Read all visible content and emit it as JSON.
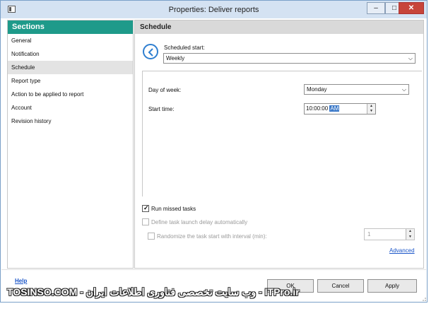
{
  "window": {
    "title": "Properties: Deliver reports",
    "minimize_label": "–",
    "maximize_label": "□",
    "close_label": "✕"
  },
  "sidebar": {
    "header": "Sections",
    "items": [
      {
        "label": "General"
      },
      {
        "label": "Notification"
      },
      {
        "label": "Schedule",
        "selected": true
      },
      {
        "label": "Report type"
      },
      {
        "label": "Action to be applied to report"
      },
      {
        "label": "Account"
      },
      {
        "label": "Revision history"
      }
    ]
  },
  "content": {
    "header": "Schedule",
    "scheduled_start": {
      "label": "Scheduled start:",
      "value": "Weekly"
    },
    "day_of_week": {
      "label": "Day of week:",
      "value": "Monday"
    },
    "start_time": {
      "label": "Start time:",
      "time_value": "10:00:00",
      "ampm_value": "AM"
    },
    "run_missed_tasks": {
      "label": "Run missed tasks",
      "checked": true
    },
    "define_delay": {
      "label": "Define task launch delay automatically",
      "checked": false,
      "enabled": false
    },
    "randomize": {
      "label": "Randomize the task start with interval (min):",
      "checked": false,
      "enabled": false,
      "value": "1"
    },
    "advanced_link": "Advanced"
  },
  "footer": {
    "help_link": "Help",
    "ok_label": "OK",
    "cancel_label": "Cancel",
    "apply_label": "Apply"
  },
  "watermark": "TOSINSO.COM - وب سایت تخصصی فناوری اطلاعات ایران - ITPro.ir"
}
